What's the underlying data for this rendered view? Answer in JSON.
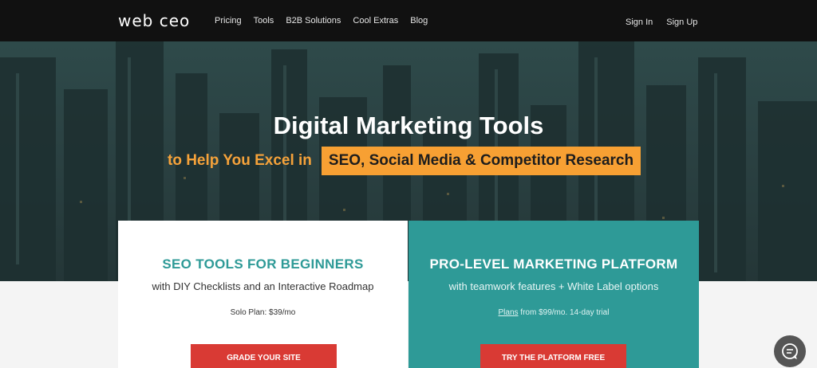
{
  "nav": {
    "logo": "web ceo",
    "links": [
      "Pricing",
      "Tools",
      "B2B Solutions",
      "Cool Extras",
      "Blog"
    ],
    "sign_in": "Sign In",
    "sign_up": "Sign Up"
  },
  "hero": {
    "title": "Digital Marketing Tools",
    "lead": "to Help You Excel in",
    "highlight": "SEO, Social Media & Competitor Research"
  },
  "cards": {
    "left": {
      "title": "SEO TOOLS FOR BEGINNERS",
      "subtitle": "with DIY Checklists and an Interactive Roadmap",
      "price": "Solo Plan: $39/mo",
      "cta": "GRADE YOUR SITE"
    },
    "right": {
      "title": "PRO-LEVEL MARKETING PLATFORM",
      "subtitle": "with teamwork features + White Label options",
      "plans_link": "Plans",
      "price_rest": " from $99/mo. 14-day trial",
      "cta": "TRY THE PLATFORM FREE"
    }
  },
  "colors": {
    "accent_orange": "#f7a033",
    "teal": "#2e9a97",
    "cta_red": "#d93a34",
    "nav_bg": "#111111"
  },
  "icons": {
    "chat": "chat-bubble-icon"
  }
}
